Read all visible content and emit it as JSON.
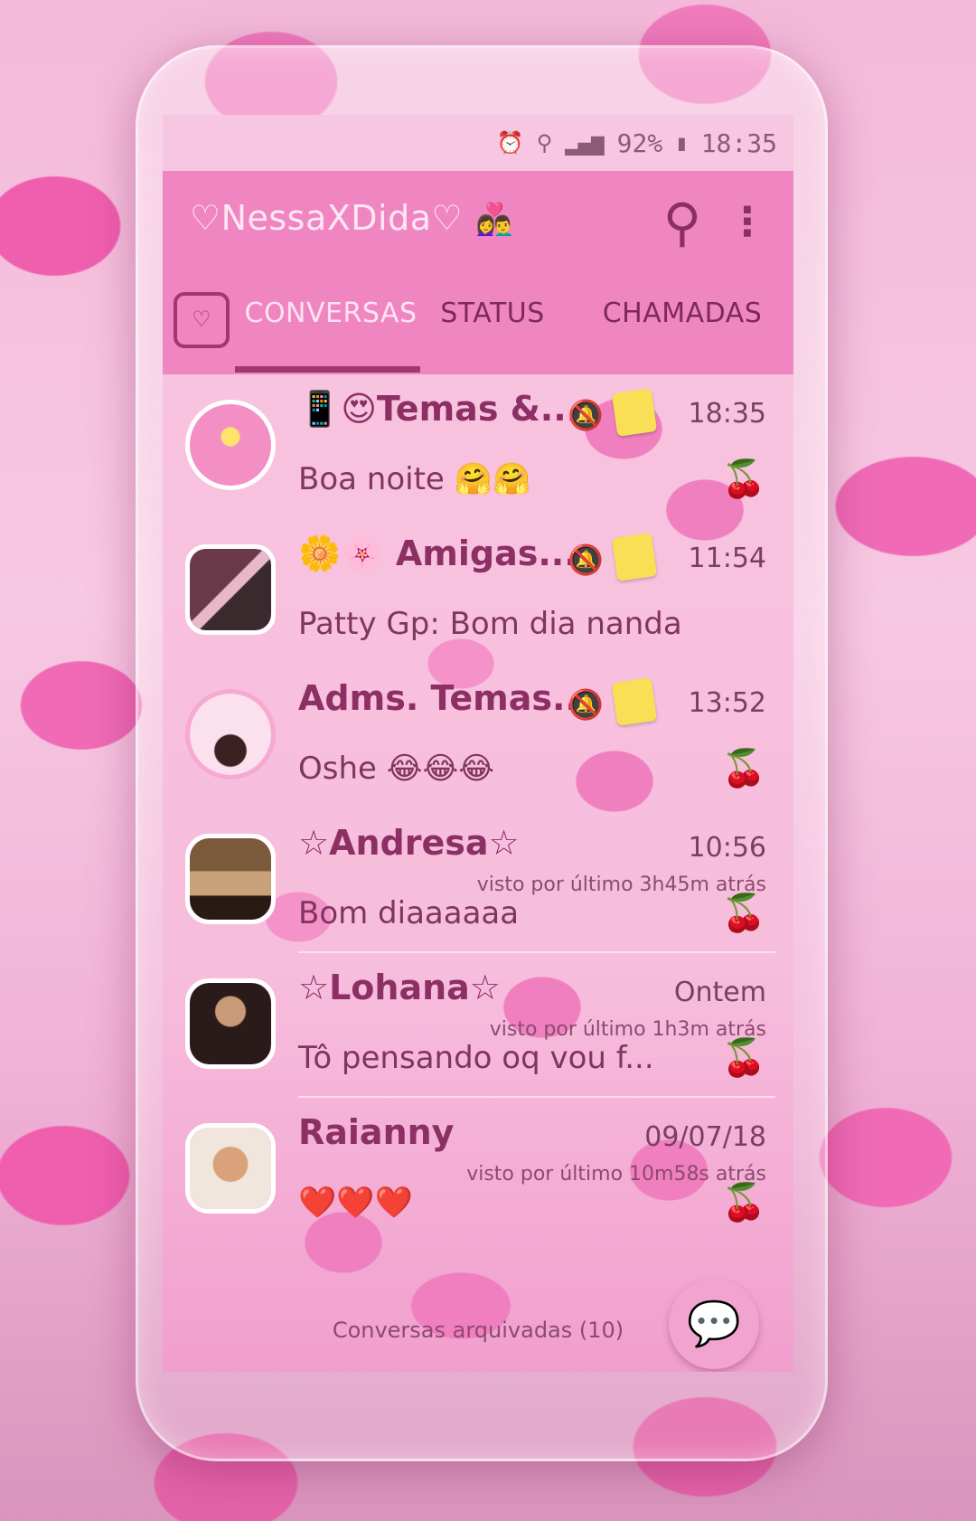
{
  "status_bar": {
    "battery": "92%",
    "time": "18:35",
    "icons": [
      "alarm-icon",
      "wifi-icon",
      "signal-icon",
      "battery-icon"
    ]
  },
  "app_bar": {
    "title": "♡NessaXDida♡",
    "title_emoji": "👩‍❤️‍👨",
    "search_icon": "search-icon",
    "menu_icon": "more-vert-icon"
  },
  "tabs": [
    {
      "label": "CONVERSAS",
      "active": true
    },
    {
      "label": "STATUS",
      "active": false
    },
    {
      "label": "CHAMADAS",
      "active": false
    }
  ],
  "chats": [
    {
      "name": "📱😍Temas &...",
      "time": "18:35",
      "message": "Boa noite 🤗🤗",
      "muted": true,
      "pinned_note": true,
      "seen": ""
    },
    {
      "name": "🌼🌸 Amigas...",
      "time": "11:54",
      "message": "Patty Gp: Bom dia nanda",
      "muted": true,
      "pinned_note": true,
      "seen": ""
    },
    {
      "name": "Adms. Temas...",
      "time": "13:52",
      "message": "Oshe 😂😂😂",
      "muted": true,
      "pinned_note": true,
      "seen": ""
    },
    {
      "name": "☆Andresa☆",
      "time": "10:56",
      "message": "Bom diaaaaaa",
      "muted": false,
      "pinned_note": false,
      "seen": "visto por último 3h45m atrás"
    },
    {
      "name": "☆Lohana☆",
      "time": "Ontem",
      "message": "Tô pensando oq vou f...",
      "muted": false,
      "pinned_note": false,
      "seen": "visto por último 1h3m atrás"
    },
    {
      "name": "Raianny",
      "time": "09/07/18",
      "message": "❤️❤️❤️",
      "muted": false,
      "pinned_note": false,
      "seen": "visto por último 10m58s atrás"
    }
  ],
  "archived": "Conversas arquivadas (10)",
  "fab_icon": "new-chat-icon",
  "colors": {
    "appbar": "#ef86c2",
    "accent": "#a0386f",
    "text": "#8c2f64"
  }
}
